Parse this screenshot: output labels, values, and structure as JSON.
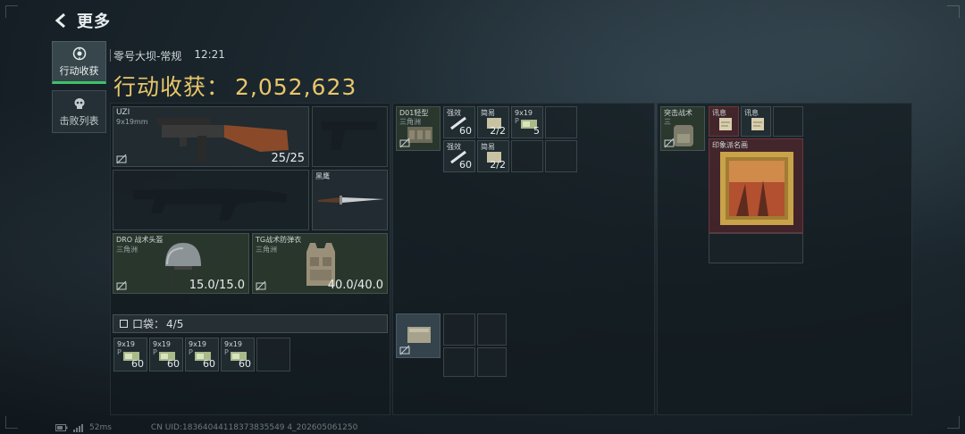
{
  "header": {
    "title": "更多"
  },
  "sidebar": {
    "tabs": [
      {
        "label": "行动收获",
        "active": true
      },
      {
        "label": "击败列表",
        "active": false
      }
    ]
  },
  "raid": {
    "map": "零号大坝-常规",
    "time": "12:21"
  },
  "haul": {
    "label": "行动收获：",
    "value": "2,052,623"
  },
  "loadout": {
    "primary": {
      "name": "UZI",
      "caliber": "9x19mm",
      "durability": "25/25"
    },
    "melee": {
      "name": "黑鹰"
    },
    "helmet": {
      "name": "DRO 战术头盔",
      "origin": "三角洲",
      "durability": "15.0/15.0"
    },
    "armor": {
      "name": "TG战术防弹衣",
      "origin": "三角洲",
      "durability": "40.0/40.0"
    },
    "pocket": {
      "label": "口袋：",
      "value": "4/5"
    },
    "pocket_items": [
      {
        "name": "9x19",
        "sub": "P",
        "count": "60"
      },
      {
        "name": "9x19",
        "sub": "P",
        "count": "60"
      },
      {
        "name": "9x19",
        "sub": "P",
        "count": "60"
      },
      {
        "name": "9x19",
        "sub": "P",
        "count": "60"
      }
    ]
  },
  "chest_rig": {
    "name": "D01轻型",
    "origin": "三角洲",
    "items": [
      {
        "name": "强效",
        "count": "60"
      },
      {
        "name": "简易",
        "count": "2/2"
      },
      {
        "name": "9x19",
        "sub": "P",
        "count": "5"
      },
      {
        "name": "强效",
        "count": "60"
      },
      {
        "name": "简易",
        "count": "2/2"
      }
    ]
  },
  "backpack": {
    "name": "突击战术",
    "origin": "三",
    "items": [
      {
        "name": "讯息"
      },
      {
        "name": "讯息"
      },
      {
        "name": "印象派名画"
      }
    ]
  },
  "footer": {
    "ping": "52ms",
    "uid": "CN UID:18364044118373835549 4_202605061250"
  },
  "colors": {
    "accent_green": "#3ec16b",
    "haul_gold": "#e8c66a",
    "rare_red": "#5f282d"
  }
}
